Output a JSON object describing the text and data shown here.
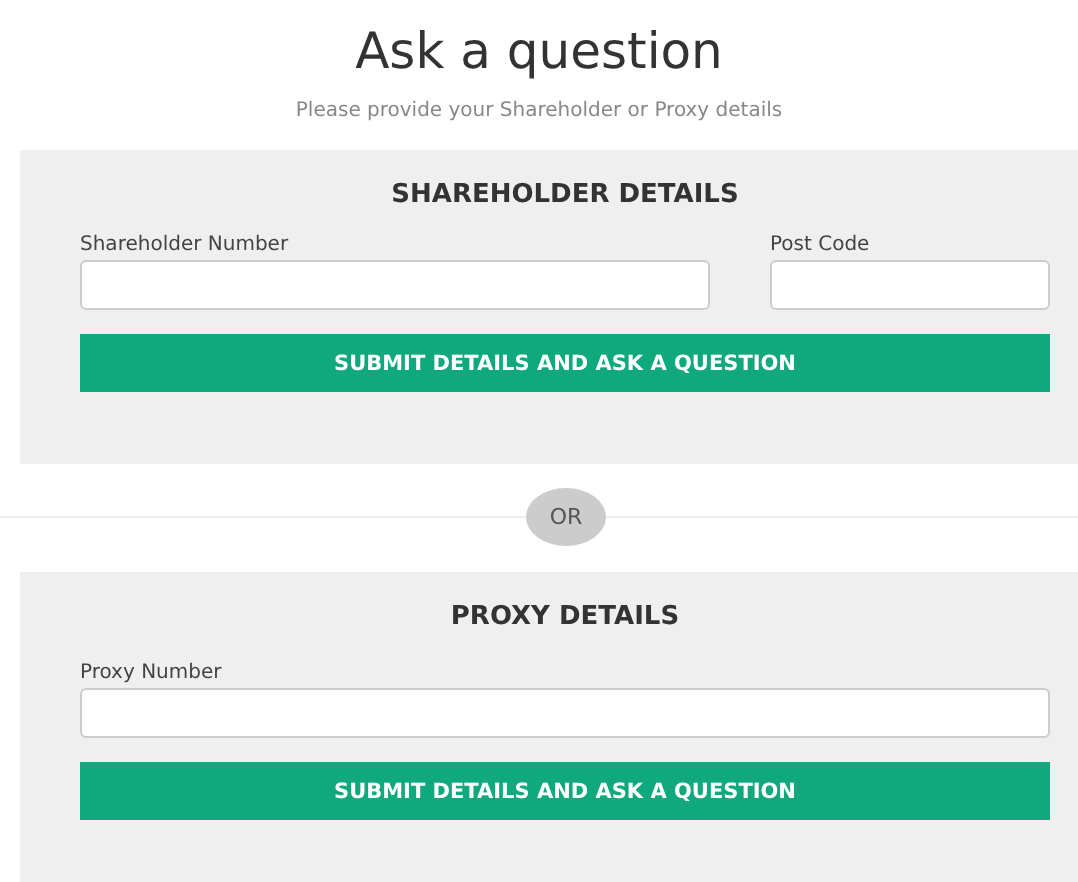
{
  "title": "Ask a question",
  "subtitle": "Please provide your Shareholder or Proxy details",
  "sections": [
    {
      "heading": "SHAREHOLDER DETAILS",
      "fields": [
        {
          "label": "Shareholder Number",
          "wide": true
        },
        {
          "label": "Post Code",
          "wide": false
        }
      ],
      "button": "SUBMIT DETAILS AND ASK A QUESTION"
    },
    {
      "heading": "PROXY DETAILS",
      "fields": [
        {
          "label": "Proxy Number",
          "wide": true
        }
      ],
      "button": "SUBMIT DETAILS AND ASK A QUESTION"
    }
  ],
  "divider": "OR"
}
